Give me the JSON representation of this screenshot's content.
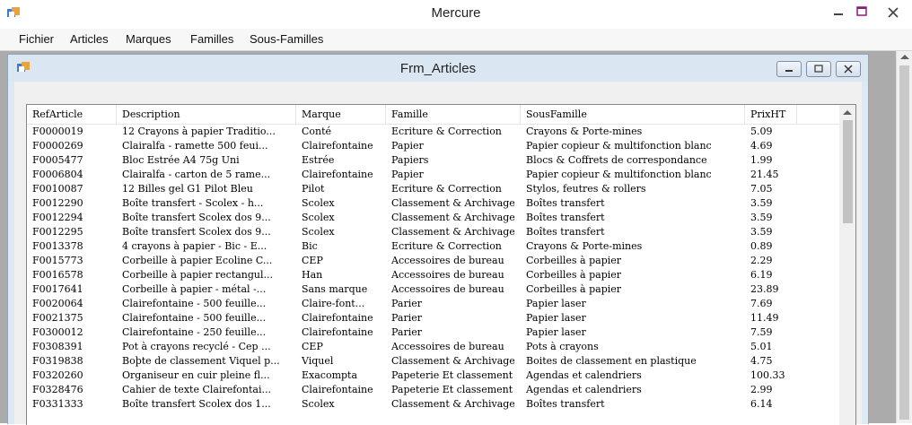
{
  "window": {
    "title": "Mercure"
  },
  "menu": [
    "Fichier",
    "Articles",
    "Marques",
    "Familles",
    "Sous-Familles"
  ],
  "child_window": {
    "title": "Frm_Articles"
  },
  "grid": {
    "columns": [
      "RefArticle",
      "Description",
      "Marque",
      "Famille",
      "SousFamille",
      "PrixHT"
    ],
    "rows": [
      [
        "F0000019",
        "12 Crayons à papier Traditio...",
        "Conté",
        "Ecriture & Correction",
        "Crayons & Porte-mines",
        "5.09"
      ],
      [
        "F0000269",
        "Clairalfa - ramette 500 feui...",
        "Clairefontaine",
        "Papier",
        "Papier copieur & multifonction blanc",
        "4.69"
      ],
      [
        "F0005477",
        "Bloc Estrée A4 75g Uni",
        "Estrée",
        "Papiers",
        "Blocs & Coffrets de correspondance",
        "1.99"
      ],
      [
        "F0006804",
        "Clairalfa - carton de 5 rame...",
        "Clairefontaine",
        "Papier",
        "Papier copieur & multifonction blanc",
        "21.45"
      ],
      [
        "F0010087",
        "12 Billes gel G1 Pilot Bleu",
        "Pilot",
        "Ecriture & Correction",
        "Stylos, feutres & rollers",
        "7.05"
      ],
      [
        "F0012290",
        "Boîte transfert - Scolex - h...",
        "Scolex",
        "Classement & Archivage",
        "Boîtes transfert",
        "3.59"
      ],
      [
        "F0012294",
        "Boîte transfert Scolex dos 9...",
        "Scolex",
        "Classement & Archivage",
        "Boîtes transfert",
        "3.59"
      ],
      [
        "F0012295",
        "Boîte transfert Scolex dos 9...",
        "Scolex",
        "Classement & Archivage",
        "Boîtes transfert",
        "3.59"
      ],
      [
        "F0013378",
        "4 crayons à papier - Bic - E...",
        "Bic",
        "Ecriture & Correction",
        "Crayons & Porte-mines",
        "0.89"
      ],
      [
        "F0015773",
        "Corbeille à papier Ecoline C...",
        "CEP",
        "Accessoires de bureau",
        "Corbeilles à papier",
        "2.29"
      ],
      [
        "F0016578",
        "Corbeille à papier rectangul...",
        "Han",
        "Accessoires de bureau",
        "Corbeilles à papier",
        "6.19"
      ],
      [
        "F0017641",
        "Corbeille à papier - métal -...",
        "Sans marque",
        "Accessoires de bureau",
        "Corbeilles à papier",
        "23.89"
      ],
      [
        "F0020064",
        "Clairefontaine - 500 feuille...",
        "Claire-font...",
        "Parier",
        "Papier laser",
        "7.69"
      ],
      [
        "F0021375",
        "Clairefontaine - 500 feuille...",
        "Clairefontaine",
        "Parier",
        "Papier laser",
        "11.49"
      ],
      [
        "F0300012",
        "Clairefontaine - 250 feuille...",
        "Clairefontaine",
        "Parier",
        "Papier laser",
        "7.59"
      ],
      [
        "F0308391",
        "Pot à crayons recyclé - Cep ...",
        "CEP",
        "Accessoires de bureau",
        "Pots à crayons",
        "5.01"
      ],
      [
        "F0319838",
        "Boþte de classement Viquel p...",
        "Viquel",
        "Classement & Archivage",
        "Boites de classement en plastique",
        "4.75"
      ],
      [
        "F0320260",
        "Organiseur en cuir pleine fl...",
        "Exacompta",
        "Papeterie Et classement",
        "Agendas et calendriers",
        "100.33"
      ],
      [
        "F0328476",
        "Cahier de texte Clairefontai...",
        "Clairefontaine",
        "Papeterie Et classement",
        "Agendas et calendriers",
        "2.99"
      ],
      [
        "F0331333",
        "Boîte transfert Scolex dos 1...",
        "Scolex",
        "Classement & Archivage",
        "Boîtes transfert",
        "6.14"
      ]
    ]
  }
}
